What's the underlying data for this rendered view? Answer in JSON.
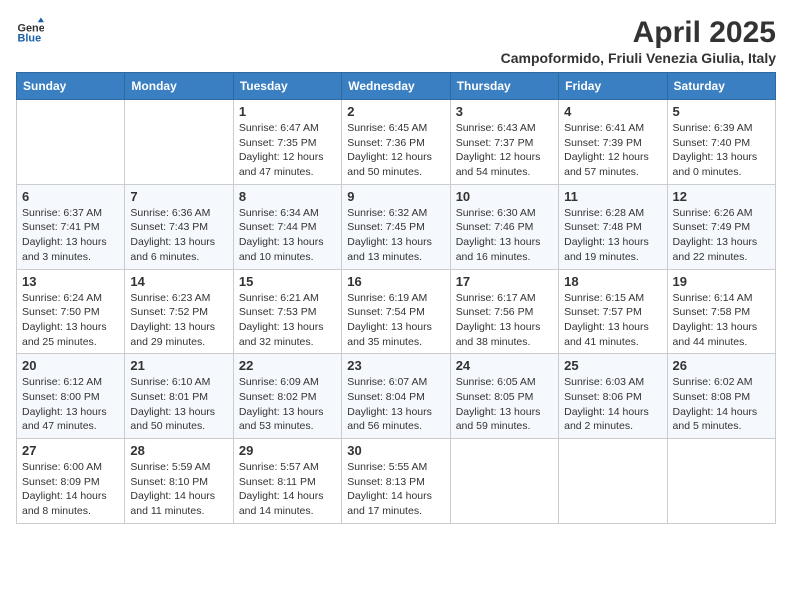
{
  "logo": {
    "line1": "General",
    "line2": "Blue"
  },
  "title": "April 2025",
  "subtitle": "Campoformido, Friuli Venezia Giulia, Italy",
  "days_of_week": [
    "Sunday",
    "Monday",
    "Tuesday",
    "Wednesday",
    "Thursday",
    "Friday",
    "Saturday"
  ],
  "weeks": [
    [
      {
        "date": "",
        "sunrise": "",
        "sunset": "",
        "daylight": ""
      },
      {
        "date": "",
        "sunrise": "",
        "sunset": "",
        "daylight": ""
      },
      {
        "date": "1",
        "sunrise": "Sunrise: 6:47 AM",
        "sunset": "Sunset: 7:35 PM",
        "daylight": "Daylight: 12 hours and 47 minutes."
      },
      {
        "date": "2",
        "sunrise": "Sunrise: 6:45 AM",
        "sunset": "Sunset: 7:36 PM",
        "daylight": "Daylight: 12 hours and 50 minutes."
      },
      {
        "date": "3",
        "sunrise": "Sunrise: 6:43 AM",
        "sunset": "Sunset: 7:37 PM",
        "daylight": "Daylight: 12 hours and 54 minutes."
      },
      {
        "date": "4",
        "sunrise": "Sunrise: 6:41 AM",
        "sunset": "Sunset: 7:39 PM",
        "daylight": "Daylight: 12 hours and 57 minutes."
      },
      {
        "date": "5",
        "sunrise": "Sunrise: 6:39 AM",
        "sunset": "Sunset: 7:40 PM",
        "daylight": "Daylight: 13 hours and 0 minutes."
      }
    ],
    [
      {
        "date": "6",
        "sunrise": "Sunrise: 6:37 AM",
        "sunset": "Sunset: 7:41 PM",
        "daylight": "Daylight: 13 hours and 3 minutes."
      },
      {
        "date": "7",
        "sunrise": "Sunrise: 6:36 AM",
        "sunset": "Sunset: 7:43 PM",
        "daylight": "Daylight: 13 hours and 6 minutes."
      },
      {
        "date": "8",
        "sunrise": "Sunrise: 6:34 AM",
        "sunset": "Sunset: 7:44 PM",
        "daylight": "Daylight: 13 hours and 10 minutes."
      },
      {
        "date": "9",
        "sunrise": "Sunrise: 6:32 AM",
        "sunset": "Sunset: 7:45 PM",
        "daylight": "Daylight: 13 hours and 13 minutes."
      },
      {
        "date": "10",
        "sunrise": "Sunrise: 6:30 AM",
        "sunset": "Sunset: 7:46 PM",
        "daylight": "Daylight: 13 hours and 16 minutes."
      },
      {
        "date": "11",
        "sunrise": "Sunrise: 6:28 AM",
        "sunset": "Sunset: 7:48 PM",
        "daylight": "Daylight: 13 hours and 19 minutes."
      },
      {
        "date": "12",
        "sunrise": "Sunrise: 6:26 AM",
        "sunset": "Sunset: 7:49 PM",
        "daylight": "Daylight: 13 hours and 22 minutes."
      }
    ],
    [
      {
        "date": "13",
        "sunrise": "Sunrise: 6:24 AM",
        "sunset": "Sunset: 7:50 PM",
        "daylight": "Daylight: 13 hours and 25 minutes."
      },
      {
        "date": "14",
        "sunrise": "Sunrise: 6:23 AM",
        "sunset": "Sunset: 7:52 PM",
        "daylight": "Daylight: 13 hours and 29 minutes."
      },
      {
        "date": "15",
        "sunrise": "Sunrise: 6:21 AM",
        "sunset": "Sunset: 7:53 PM",
        "daylight": "Daylight: 13 hours and 32 minutes."
      },
      {
        "date": "16",
        "sunrise": "Sunrise: 6:19 AM",
        "sunset": "Sunset: 7:54 PM",
        "daylight": "Daylight: 13 hours and 35 minutes."
      },
      {
        "date": "17",
        "sunrise": "Sunrise: 6:17 AM",
        "sunset": "Sunset: 7:56 PM",
        "daylight": "Daylight: 13 hours and 38 minutes."
      },
      {
        "date": "18",
        "sunrise": "Sunrise: 6:15 AM",
        "sunset": "Sunset: 7:57 PM",
        "daylight": "Daylight: 13 hours and 41 minutes."
      },
      {
        "date": "19",
        "sunrise": "Sunrise: 6:14 AM",
        "sunset": "Sunset: 7:58 PM",
        "daylight": "Daylight: 13 hours and 44 minutes."
      }
    ],
    [
      {
        "date": "20",
        "sunrise": "Sunrise: 6:12 AM",
        "sunset": "Sunset: 8:00 PM",
        "daylight": "Daylight: 13 hours and 47 minutes."
      },
      {
        "date": "21",
        "sunrise": "Sunrise: 6:10 AM",
        "sunset": "Sunset: 8:01 PM",
        "daylight": "Daylight: 13 hours and 50 minutes."
      },
      {
        "date": "22",
        "sunrise": "Sunrise: 6:09 AM",
        "sunset": "Sunset: 8:02 PM",
        "daylight": "Daylight: 13 hours and 53 minutes."
      },
      {
        "date": "23",
        "sunrise": "Sunrise: 6:07 AM",
        "sunset": "Sunset: 8:04 PM",
        "daylight": "Daylight: 13 hours and 56 minutes."
      },
      {
        "date": "24",
        "sunrise": "Sunrise: 6:05 AM",
        "sunset": "Sunset: 8:05 PM",
        "daylight": "Daylight: 13 hours and 59 minutes."
      },
      {
        "date": "25",
        "sunrise": "Sunrise: 6:03 AM",
        "sunset": "Sunset: 8:06 PM",
        "daylight": "Daylight: 14 hours and 2 minutes."
      },
      {
        "date": "26",
        "sunrise": "Sunrise: 6:02 AM",
        "sunset": "Sunset: 8:08 PM",
        "daylight": "Daylight: 14 hours and 5 minutes."
      }
    ],
    [
      {
        "date": "27",
        "sunrise": "Sunrise: 6:00 AM",
        "sunset": "Sunset: 8:09 PM",
        "daylight": "Daylight: 14 hours and 8 minutes."
      },
      {
        "date": "28",
        "sunrise": "Sunrise: 5:59 AM",
        "sunset": "Sunset: 8:10 PM",
        "daylight": "Daylight: 14 hours and 11 minutes."
      },
      {
        "date": "29",
        "sunrise": "Sunrise: 5:57 AM",
        "sunset": "Sunset: 8:11 PM",
        "daylight": "Daylight: 14 hours and 14 minutes."
      },
      {
        "date": "30",
        "sunrise": "Sunrise: 5:55 AM",
        "sunset": "Sunset: 8:13 PM",
        "daylight": "Daylight: 14 hours and 17 minutes."
      },
      {
        "date": "",
        "sunrise": "",
        "sunset": "",
        "daylight": ""
      },
      {
        "date": "",
        "sunrise": "",
        "sunset": "",
        "daylight": ""
      },
      {
        "date": "",
        "sunrise": "",
        "sunset": "",
        "daylight": ""
      }
    ]
  ]
}
